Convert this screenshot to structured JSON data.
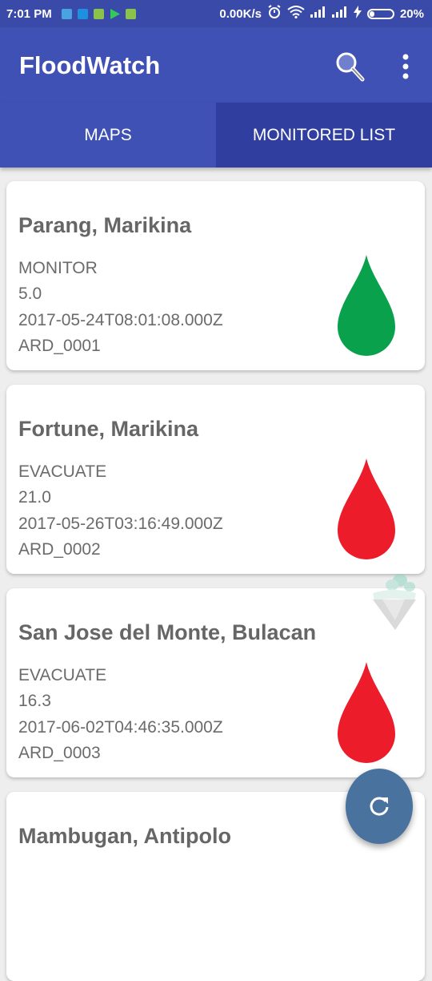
{
  "status_bar": {
    "time": "7:01 PM",
    "net_speed": "0.00K/s",
    "battery_percent": "20%",
    "battery_level": 0.2
  },
  "app_bar": {
    "title": "FloodWatch",
    "search_icon": "search-icon",
    "overflow_icon": "more-vert-icon"
  },
  "tabs": [
    {
      "label": "MAPS",
      "selected": false
    },
    {
      "label": "MONITORED LIST",
      "selected": true
    }
  ],
  "stations": [
    {
      "name": "Parang, Marikina",
      "status": "MONITOR",
      "level": "5.0",
      "timestamp": "2017-05-24T08:01:08.000Z",
      "id": "ARD_0001",
      "drop_color": "#0aa14c"
    },
    {
      "name": "Fortune, Marikina",
      "status": "EVACUATE",
      "level": "21.0",
      "timestamp": "2017-05-26T03:16:49.000Z",
      "id": "ARD_0002",
      "drop_color": "#ec1c2a"
    },
    {
      "name": "San Jose del Monte, Bulacan",
      "status": "EVACUATE",
      "level": "16.3",
      "timestamp": "2017-06-02T04:46:35.000Z",
      "id": "ARD_0003",
      "drop_color": "#ec1c2a"
    },
    {
      "name": "Mambugan, Antipolo"
    }
  ],
  "fab": {
    "icon": "refresh-icon"
  },
  "colors": {
    "primary": "#3f51b5",
    "primary_dark": "#303f9f",
    "fab": "#49729f",
    "monitor": "#0aa14c",
    "evacuate": "#ec1c2a"
  }
}
